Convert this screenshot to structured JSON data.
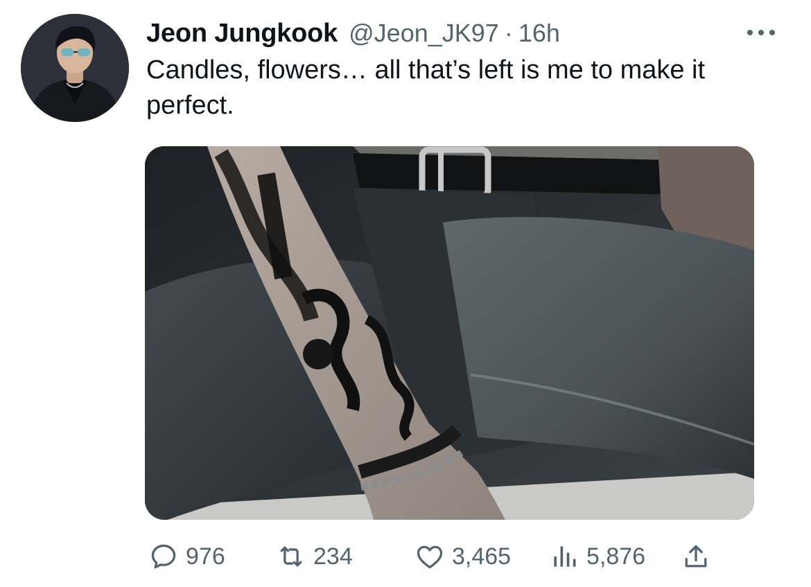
{
  "tweet": {
    "display_name": "Jeon Jungkook",
    "handle": "@Jeon_JK97",
    "separator": "·",
    "time": "16h",
    "text": "Candles, flowers… all that’s left is me to make it perfect."
  },
  "actions": {
    "replies": "976",
    "retweets": "234",
    "likes": "3,465",
    "views": "5,876"
  },
  "icons": {
    "reply": "reply-icon",
    "retweet": "retweet-icon",
    "like": "heart-icon",
    "views": "views-icon",
    "share": "share-icon",
    "more": "more-dots-icon"
  },
  "colors": {
    "text_primary": "#0f1419",
    "text_secondary": "#536471",
    "background": "#ffffff"
  }
}
